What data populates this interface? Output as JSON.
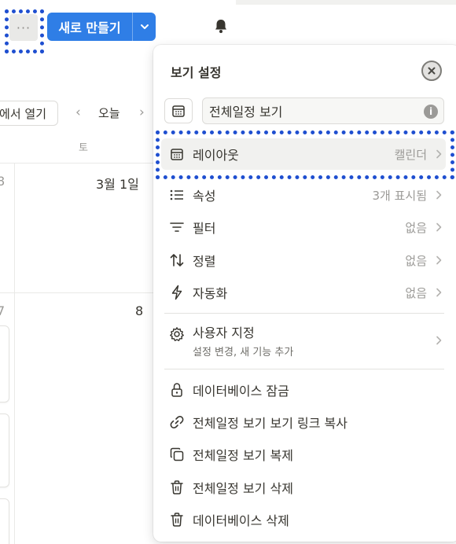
{
  "topbar": {
    "more_glyph": "···",
    "new_button_label": "새로 만들기"
  },
  "calendar": {
    "open_button_label": "에서 열기",
    "today_label": "오늘",
    "prev_glyph": "‹",
    "next_glyph": "›",
    "day_header": "토",
    "date_edge_a": "8",
    "date_main_a": "3월 1일",
    "date_edge_b": "7",
    "date_main_b": "8"
  },
  "panel": {
    "title": "보기 설정",
    "view_name_value": "전체일정 보기",
    "info_glyph": "i",
    "items": [
      {
        "label": "레이아웃",
        "value": "캘린더",
        "icon": "calendar-icon"
      },
      {
        "label": "속성",
        "value": "3개 표시됨",
        "icon": "list-icon"
      },
      {
        "label": "필터",
        "value": "없음",
        "icon": "filter-icon"
      },
      {
        "label": "정렬",
        "value": "없음",
        "icon": "sort-icon"
      },
      {
        "label": "자동화",
        "value": "없음",
        "icon": "lightning-icon"
      }
    ],
    "customize": {
      "label": "사용자 지정",
      "subtitle": "설정 변경, 새 기능 추가",
      "icon": "gear-icon"
    },
    "actions": [
      {
        "label": "데이터베이스 잠금",
        "icon": "lock-icon"
      },
      {
        "label": "전체일정 보기 보기 링크 복사",
        "icon": "link-icon"
      },
      {
        "label": "전체일정 보기 복제",
        "icon": "duplicate-icon"
      },
      {
        "label": "전체일정 보기 삭제",
        "icon": "trash-icon"
      },
      {
        "label": "데이터베이스 삭제",
        "icon": "trash-icon"
      }
    ]
  },
  "colors": {
    "accent": "#2f7ee6",
    "highlight_dots": "#1f4fd0",
    "muted_text": "#9b9a97"
  }
}
